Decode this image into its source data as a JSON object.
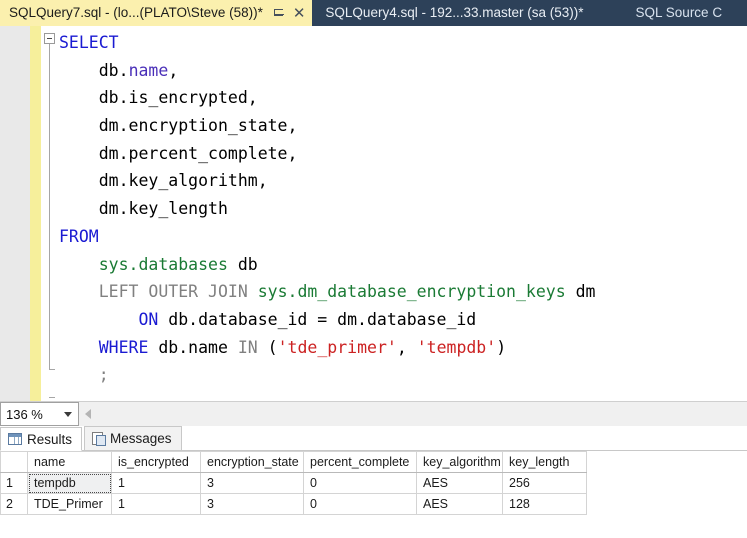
{
  "tabs": [
    {
      "title": "SQLQuery7.sql - (lo...(PLATO\\Steve (58))*",
      "active": true,
      "pin_icon": "pin-icon",
      "close_icon": "close-icon",
      "close_glyph": "✕"
    },
    {
      "title": "SQLQuery4.sql - 192...33.master (sa (53))*",
      "active": false
    }
  ],
  "toolwindow_label": "SQL Source C",
  "editor": {
    "collapse_state": "expanded",
    "lines": [
      {
        "indent": 0,
        "tokens": [
          {
            "t": "SELECT",
            "c": "kw"
          }
        ]
      },
      {
        "indent": 4,
        "tokens": [
          {
            "t": "db.",
            "c": "plain"
          },
          {
            "t": "name",
            "c": "col"
          },
          {
            "t": ",",
            "c": "plain"
          }
        ]
      },
      {
        "indent": 4,
        "tokens": [
          {
            "t": "db.is_encrypted",
            "c": "plain"
          },
          {
            "t": ",",
            "c": "plain"
          }
        ]
      },
      {
        "indent": 4,
        "tokens": [
          {
            "t": "dm.encryption_state",
            "c": "plain"
          },
          {
            "t": ",",
            "c": "plain"
          }
        ]
      },
      {
        "indent": 4,
        "tokens": [
          {
            "t": "dm.percent_complete",
            "c": "plain"
          },
          {
            "t": ",",
            "c": "plain"
          }
        ]
      },
      {
        "indent": 4,
        "tokens": [
          {
            "t": "dm.key_algorithm",
            "c": "plain"
          },
          {
            "t": ",",
            "c": "plain"
          }
        ]
      },
      {
        "indent": 4,
        "tokens": [
          {
            "t": "dm.key_length",
            "c": "plain"
          }
        ]
      },
      {
        "indent": 0,
        "tokens": [
          {
            "t": "FROM",
            "c": "kw"
          }
        ]
      },
      {
        "indent": 4,
        "tokens": [
          {
            "t": "sys.databases",
            "c": "obj"
          },
          {
            "t": " db",
            "c": "plain"
          }
        ]
      },
      {
        "indent": 4,
        "tokens": [
          {
            "t": "LEFT OUTER JOIN",
            "c": "kwg"
          },
          {
            "t": " ",
            "c": "plain"
          },
          {
            "t": "sys.dm_database_encryption_keys",
            "c": "obj"
          },
          {
            "t": " dm",
            "c": "plain"
          }
        ]
      },
      {
        "indent": 8,
        "tokens": [
          {
            "t": "ON",
            "c": "kw"
          },
          {
            "t": " db.database_id = dm.database_id",
            "c": "plain"
          }
        ]
      },
      {
        "indent": 4,
        "tokens": [
          {
            "t": "WHERE",
            "c": "kw"
          },
          {
            "t": " db.",
            "c": "plain"
          },
          {
            "t": "name",
            "c": "plain"
          },
          {
            "t": " ",
            "c": "plain"
          },
          {
            "t": "IN",
            "c": "kwg"
          },
          {
            "t": " (",
            "c": "plain"
          },
          {
            "t": "'tde_primer'",
            "c": "str"
          },
          {
            "t": ", ",
            "c": "plain"
          },
          {
            "t": "'tempdb'",
            "c": "str"
          },
          {
            "t": ")",
            "c": "plain"
          }
        ]
      },
      {
        "indent": 4,
        "tokens": [
          {
            "t": ";",
            "c": "kwg"
          }
        ]
      }
    ]
  },
  "zoombar": {
    "zoom_value": "136 %",
    "dropdown_icon": "chevron-down-icon",
    "scroll_left_icon": "scroll-left-arrow-icon"
  },
  "results": {
    "tabs": [
      {
        "label": "Results",
        "icon": "grid-icon",
        "active": true
      },
      {
        "label": "Messages",
        "icon": "messages-icon",
        "active": false
      }
    ],
    "grid": {
      "row_header": "",
      "columns": [
        "name",
        "is_encrypted",
        "encryption_state",
        "percent_complete",
        "key_algorithm",
        "key_length"
      ],
      "rows": [
        {
          "num": "1",
          "cells": [
            "tempdb",
            "1",
            "3",
            "0",
            "AES",
            "256"
          ],
          "selected_cell_index": 0
        },
        {
          "num": "2",
          "cells": [
            "TDE_Primer",
            "1",
            "3",
            "0",
            "AES",
            "128"
          ],
          "selected_cell_index": -1
        }
      ]
    }
  },
  "colors": {
    "tab_active_bg": "#fbf0ae",
    "tab_bar_bg": "#2d4159",
    "change_bar": "#f6ef9b",
    "keyword_blue": "#1a1ad2",
    "keyword_gray": "#808080",
    "object_green": "#1a7a34",
    "column_purple": "#4a2fb8",
    "string_red": "#cc2222"
  }
}
